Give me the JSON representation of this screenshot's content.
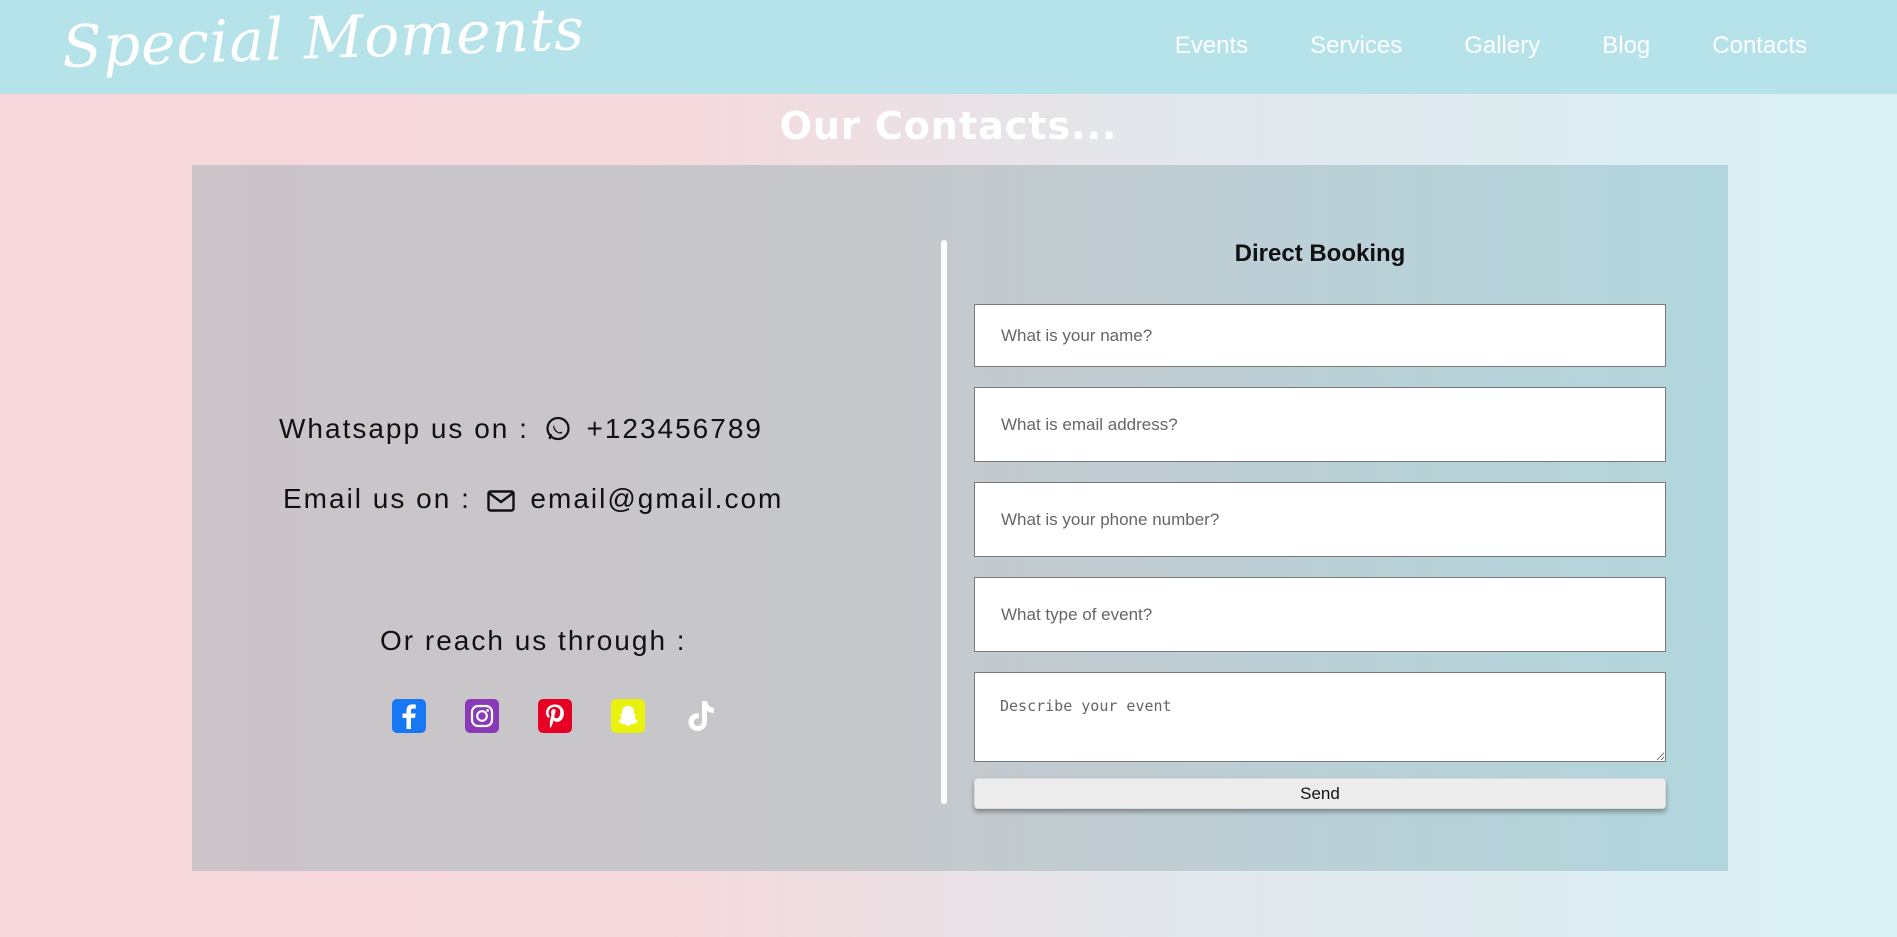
{
  "navbar": {
    "logo": "Special Moments",
    "links": [
      "Events",
      "Services",
      "Gallery",
      "Blog",
      "Contacts"
    ]
  },
  "page": {
    "title": "Our Contacts..."
  },
  "contact": {
    "whatsapp_prefix": "Whatsapp us on :",
    "whatsapp_number": "+123456789",
    "email_prefix": "Email us on :",
    "email_address": "email@gmail.com",
    "reach_text": "Or reach us through :",
    "socials": [
      {
        "icon": "facebook-icon",
        "color": "#1877f2"
      },
      {
        "icon": "instagram-icon",
        "color": "#8a3ab9"
      },
      {
        "icon": "pinterest-icon",
        "color": "#e60023"
      },
      {
        "icon": "snapchat-icon",
        "color": "#e9f20c"
      },
      {
        "icon": "tiktok-icon",
        "color": "#ffffff"
      }
    ]
  },
  "booking": {
    "title": "Direct Booking",
    "name_placeholder": "What is your name?",
    "email_placeholder": "What is email address?",
    "phone_placeholder": "What is your phone number?",
    "event_type_placeholder": "What type of event?",
    "description_placeholder": "Describe your event",
    "send_label": "Send"
  }
}
